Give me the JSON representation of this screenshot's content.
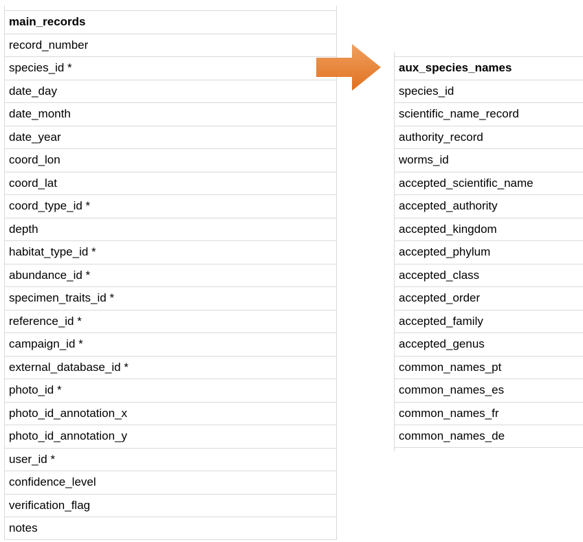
{
  "main_table": {
    "header": "main_records",
    "fields": [
      "record_number",
      "species_id *",
      "date_day",
      "date_month",
      "date_year",
      "coord_lon",
      "coord_lat",
      "coord_type_id *",
      "depth",
      "habitat_type_id *",
      "abundance_id *",
      "specimen_traits_id *",
      "reference_id *",
      "campaign_id *",
      "external_database_id *",
      "photo_id *",
      "photo_id_annotation_x",
      "photo_id_annotation_y",
      "user_id *",
      "confidence_level",
      "verification_flag",
      "notes"
    ]
  },
  "aux_table": {
    "header": "aux_species_names",
    "fields": [
      "species_id",
      "scientific_name_record",
      "authority_record",
      "worms_id",
      "accepted_scientific_name",
      "accepted_authority",
      "accepted_kingdom",
      "accepted_phylum",
      "accepted_class",
      "accepted_order",
      "accepted_family",
      "accepted_genus",
      "common_names_pt",
      "common_names_es",
      "common_names_fr",
      "common_names_de"
    ]
  },
  "colors": {
    "arrow_light": "#f0a060",
    "arrow_dark": "#e0701e",
    "grid": "#d9d9d9"
  }
}
